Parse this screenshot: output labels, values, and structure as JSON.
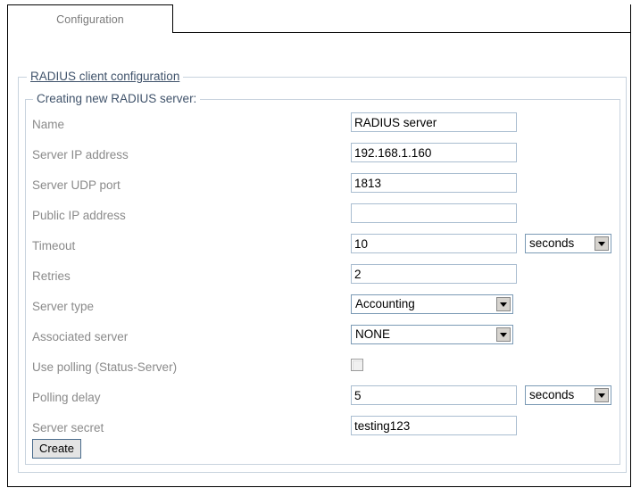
{
  "tabs": [
    {
      "label": "Configuration",
      "active": true
    }
  ],
  "outer_fieldset": {
    "legend": "RADIUS client configuration"
  },
  "inner_fieldset": {
    "legend": "Creating new RADIUS server:"
  },
  "form": {
    "rows": [
      {
        "label": "Name",
        "type": "text",
        "value": "RADIUS server"
      },
      {
        "label": "Server IP address",
        "type": "text",
        "value": "192.168.1.160"
      },
      {
        "label": "Server UDP port",
        "type": "text",
        "value": "1813"
      },
      {
        "label": "Public IP address",
        "type": "text",
        "value": ""
      },
      {
        "label": "Timeout",
        "type": "text+unit",
        "value": "10",
        "unit": "seconds"
      },
      {
        "label": "Retries",
        "type": "text",
        "value": "2"
      },
      {
        "label": "Server type",
        "type": "select",
        "value": "Accounting"
      },
      {
        "label": "Associated server",
        "type": "select",
        "value": "NONE"
      },
      {
        "label": "Use polling (Status-Server)",
        "type": "checkbox",
        "checked": false
      },
      {
        "label": "Polling delay",
        "type": "text+unit",
        "value": "5",
        "unit": "seconds"
      },
      {
        "label": "Server secret",
        "type": "text",
        "value": "testing123"
      }
    ]
  },
  "actions": {
    "create_label": "Create"
  },
  "colors": {
    "legend_text": "#40536b",
    "label_text": "#8a8a8a",
    "fieldset_border": "#c8d3de",
    "input_border": "#a9bdd0",
    "select_border": "#7b9ab5",
    "button_border": "#4a6c8c",
    "button_face": "#e4e4e4",
    "tab_text": "#7a7a7a",
    "frame": "#000000"
  }
}
